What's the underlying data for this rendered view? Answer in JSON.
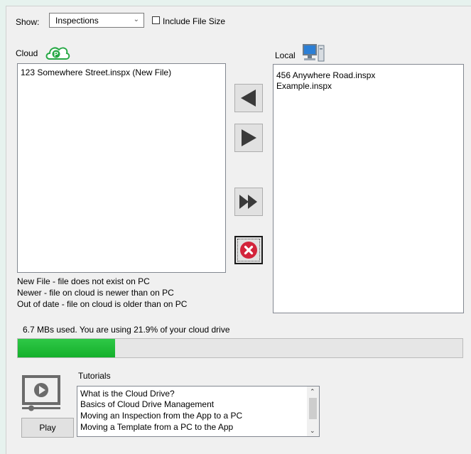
{
  "show": {
    "label": "Show:",
    "selected": "Inspections",
    "include_file_size_label": "Include File Size",
    "include_file_size_checked": false
  },
  "cloud": {
    "label": "Cloud",
    "files": [
      "123 Somewhere Street.inspx (New File)"
    ]
  },
  "local": {
    "label": "Local",
    "files": [
      "456 Anywhere Road.inspx",
      "Example.inspx"
    ]
  },
  "legend": [
    "New File - file does not exist on PC",
    "Newer - file on cloud is newer than on PC",
    "Out of date - file on cloud is older than on PC"
  ],
  "usage": {
    "text": "6.7 MBs used. You are using 21.9% of your cloud drive",
    "percent": 21.9
  },
  "tutorials": {
    "label": "Tutorials",
    "play_label": "Play",
    "items": [
      "What is the Cloud Drive?",
      "Basics of Cloud Drive Management",
      "Moving an Inspection from the App to a PC",
      "Moving a Template from a PC to the App"
    ]
  },
  "icons": {
    "cloud": "cloud-icon",
    "local": "computer-icon",
    "move_left": "arrow-left-icon",
    "move_right": "arrow-right-icon",
    "move_all": "double-arrow-right-icon",
    "delete": "delete-icon",
    "video": "video-player-icon"
  },
  "colors": {
    "progress": "#1fbf3a",
    "delete": "#d3243b"
  }
}
